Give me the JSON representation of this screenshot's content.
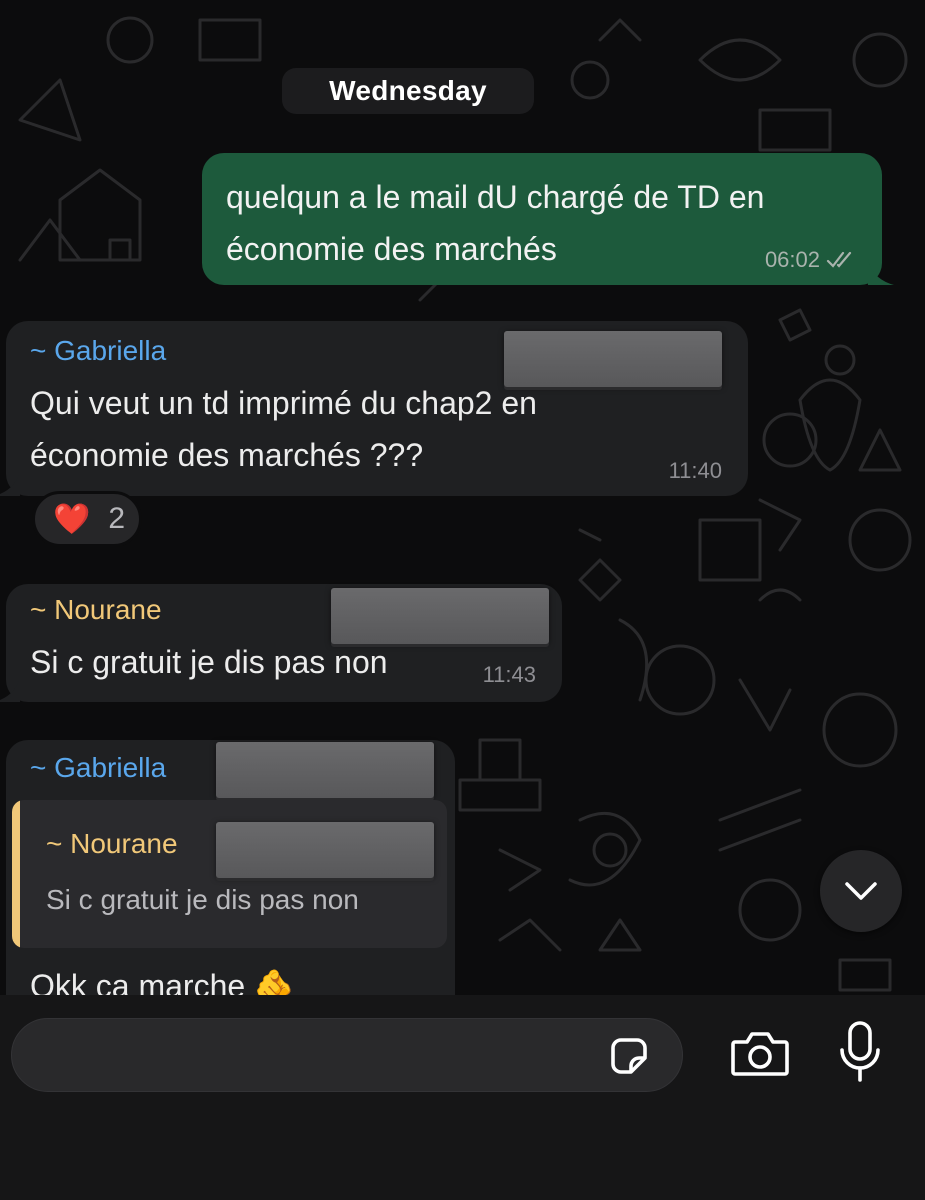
{
  "date_separator": "Wednesday",
  "messages": [
    {
      "direction": "outgoing",
      "text_line1": "quelqun a le mail dU chargé de TD en",
      "text_line2": "économie des marchés",
      "time": "06:02",
      "status_icon": "double-check-icon"
    },
    {
      "direction": "incoming",
      "sender": "~ Gabriella",
      "text_line1": "Qui veut un td imprimé du chap2 en",
      "text_line2": "économie des marchés ???",
      "time": "11:40",
      "reaction": {
        "emoji": "❤️",
        "count": "2"
      }
    },
    {
      "direction": "incoming",
      "sender": "~ Nourane",
      "text": "Si c gratuit je dis pas non",
      "time": "11:43"
    },
    {
      "direction": "incoming",
      "sender": "~ Gabriella",
      "quoted": {
        "sender": "~ Nourane",
        "text": "Si c gratuit je dis pas non"
      },
      "text": "Okk ca marche 🫵"
    }
  ],
  "colors": {
    "outgoing_bubble": "#1d5a3c",
    "incoming_bubble": "#1f2022",
    "sender_blue": "#5aa7ec",
    "sender_yellow": "#f1c879"
  },
  "composer": {
    "input_value": "",
    "icons": [
      "sticker-icon",
      "camera-icon",
      "microphone-icon"
    ]
  },
  "scroll_button_icon": "chevron-down-icon"
}
